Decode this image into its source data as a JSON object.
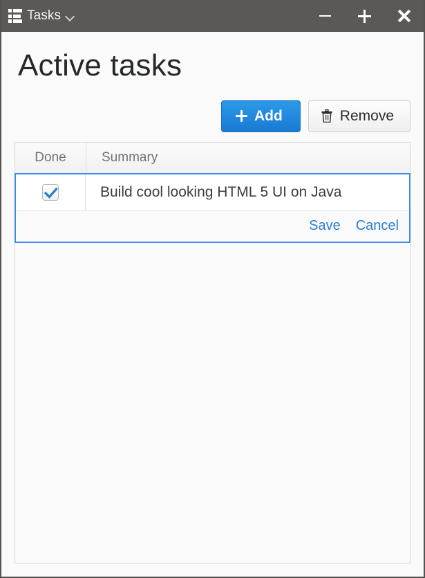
{
  "window": {
    "title": "Tasks",
    "app_icon": "list-icon",
    "title_dropdown_icon": "chevron-down-icon",
    "controls": {
      "minimize": "minimize-icon",
      "maximize": "plus-icon",
      "close": "close-icon"
    },
    "titlebar_color": "#5b5855"
  },
  "page": {
    "heading": "Active tasks"
  },
  "toolbar": {
    "add_label": "Add",
    "add_icon": "plus-icon",
    "add_color": "#1a79d4",
    "remove_label": "Remove",
    "remove_icon": "trash-icon"
  },
  "table": {
    "columns": [
      {
        "key": "done",
        "label": "Done"
      },
      {
        "key": "summary",
        "label": "Summary"
      }
    ],
    "rows": [
      {
        "done": true,
        "summary": "Build cool looking HTML 5 UI on Java",
        "selected": true,
        "actions": [
          {
            "key": "save",
            "label": "Save"
          },
          {
            "key": "cancel",
            "label": "Cancel"
          }
        ]
      }
    ],
    "selection_color": "#3c8de0",
    "link_color": "#2b7fd4"
  }
}
